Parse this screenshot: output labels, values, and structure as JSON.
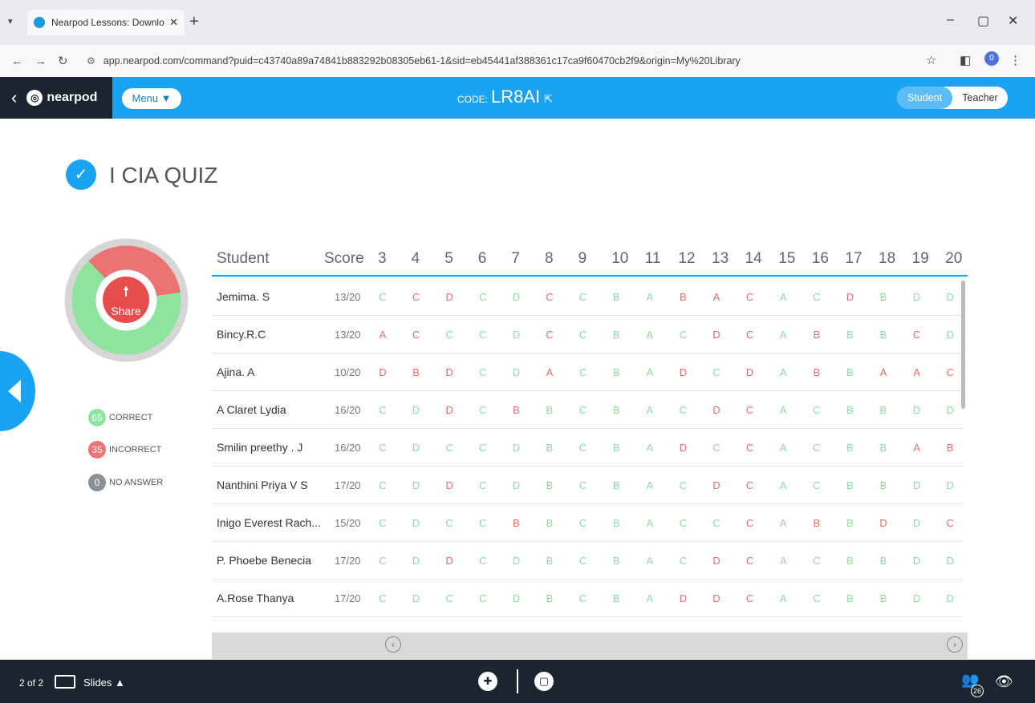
{
  "browser": {
    "tab_title": "Nearpod Lessons: Download re",
    "url": "app.nearpod.com/command?puid=c43740a89a74841b883292b08305eb61-1&sid=eb45441af388361c17ca9f60470cb2f9&origin=My%20Library",
    "profile_initial": "0"
  },
  "header": {
    "logo_text": "nearpod",
    "menu_label": "Menu ▼",
    "code_label": "CODE:",
    "code_value": "LR8AI",
    "role_student": "Student",
    "role_teacher": "Teacher",
    "colors": {
      "header_blue": "#1aa3f0",
      "logo_dark": "#1a2530"
    }
  },
  "quiz": {
    "title": "I CIA QUIZ",
    "share_label": "Share",
    "results": {
      "correct": 65,
      "incorrect": 35,
      "no_answer": 0
    },
    "legend": {
      "correct_count": "65",
      "correct_label": "CORRECT",
      "incorrect_count": "35",
      "incorrect_label": "INCORRECT",
      "no_answer_count": "0",
      "no_answer_label": "NO ANSWER"
    },
    "colors": {
      "correct": "#8ee39e",
      "incorrect": "#ec7373",
      "no_answer": "#8a9096"
    }
  },
  "table": {
    "header_student": "Student",
    "header_score": "Score",
    "question_numbers": [
      "3",
      "4",
      "5",
      "6",
      "7",
      "8",
      "9",
      "10",
      "11",
      "12",
      "13",
      "14",
      "15",
      "16",
      "17",
      "18",
      "19",
      "20"
    ],
    "rows": [
      {
        "name": "Jemima. S",
        "score": "13/20",
        "answers": [
          "C",
          "C",
          "D",
          "C",
          "D",
          "C",
          "C",
          "B",
          "A",
          "B",
          "A",
          "C",
          "A",
          "C",
          "D",
          "B",
          "D",
          "D"
        ],
        "correct": [
          1,
          0,
          0,
          1,
          1,
          0,
          1,
          1,
          1,
          0,
          0,
          0,
          1,
          1,
          0,
          1,
          1,
          1
        ]
      },
      {
        "name": "Bincy.R.C",
        "score": "13/20",
        "answers": [
          "A",
          "C",
          "C",
          "C",
          "D",
          "C",
          "C",
          "B",
          "A",
          "C",
          "D",
          "C",
          "A",
          "B",
          "B",
          "B",
          "C",
          "D"
        ],
        "correct": [
          0,
          0,
          1,
          1,
          1,
          0,
          1,
          1,
          1,
          1,
          0,
          0,
          1,
          0,
          1,
          1,
          0,
          1
        ]
      },
      {
        "name": "Ajina. A",
        "score": "10/20",
        "answers": [
          "D",
          "B",
          "D",
          "C",
          "D",
          "A",
          "C",
          "B",
          "A",
          "D",
          "C",
          "D",
          "A",
          "B",
          "B",
          "A",
          "A",
          "C"
        ],
        "correct": [
          0,
          0,
          0,
          1,
          1,
          0,
          1,
          1,
          1,
          0,
          1,
          0,
          1,
          0,
          1,
          0,
          0,
          0
        ]
      },
      {
        "name": "A Claret Lydia",
        "score": "16/20",
        "answers": [
          "C",
          "D",
          "D",
          "C",
          "B",
          "B",
          "C",
          "B",
          "A",
          "C",
          "D",
          "C",
          "A",
          "C",
          "B",
          "B",
          "D",
          "D"
        ],
        "correct": [
          1,
          1,
          0,
          1,
          0,
          1,
          1,
          1,
          1,
          1,
          0,
          0,
          1,
          1,
          1,
          1,
          1,
          1
        ]
      },
      {
        "name": "Smilin preethy . J",
        "score": "16/20",
        "answers": [
          "C",
          "D",
          "C",
          "C",
          "D",
          "B",
          "C",
          "B",
          "A",
          "D",
          "C",
          "C",
          "A",
          "C",
          "B",
          "B",
          "A",
          "B"
        ],
        "correct": [
          1,
          1,
          1,
          1,
          1,
          1,
          1,
          1,
          1,
          0,
          1,
          0,
          1,
          1,
          1,
          1,
          0,
          0
        ]
      },
      {
        "name": "Nanthini Priya V S",
        "score": "17/20",
        "answers": [
          "C",
          "D",
          "D",
          "C",
          "D",
          "B",
          "C",
          "B",
          "A",
          "C",
          "D",
          "C",
          "A",
          "C",
          "B",
          "B",
          "D",
          "D"
        ],
        "correct": [
          1,
          1,
          0,
          1,
          1,
          1,
          1,
          1,
          1,
          1,
          0,
          0,
          1,
          1,
          1,
          1,
          1,
          1
        ]
      },
      {
        "name": "Inigo Everest Rach...",
        "score": "15/20",
        "answers": [
          "C",
          "D",
          "C",
          "C",
          "B",
          "B",
          "C",
          "B",
          "A",
          "C",
          "C",
          "C",
          "A",
          "B",
          "B",
          "D",
          "D",
          "C"
        ],
        "correct": [
          1,
          1,
          1,
          1,
          0,
          1,
          1,
          1,
          1,
          1,
          1,
          0,
          1,
          0,
          1,
          0,
          1,
          0
        ]
      },
      {
        "name": "P. Phoebe Benecia",
        "score": "17/20",
        "answers": [
          "C",
          "D",
          "D",
          "C",
          "D",
          "B",
          "C",
          "B",
          "A",
          "C",
          "D",
          "C",
          "A",
          "C",
          "B",
          "B",
          "D",
          "D"
        ],
        "correct": [
          1,
          1,
          0,
          1,
          1,
          1,
          1,
          1,
          1,
          1,
          0,
          0,
          1,
          1,
          1,
          1,
          1,
          1
        ]
      },
      {
        "name": "A.Rose Thanya",
        "score": "17/20",
        "answers": [
          "C",
          "D",
          "C",
          "C",
          "D",
          "B",
          "C",
          "B",
          "A",
          "D",
          "D",
          "C",
          "A",
          "C",
          "B",
          "B",
          "D",
          "D"
        ],
        "correct": [
          1,
          1,
          1,
          1,
          1,
          1,
          1,
          1,
          1,
          0,
          0,
          0,
          1,
          1,
          1,
          1,
          1,
          1
        ]
      }
    ]
  },
  "bottom_bar": {
    "slide_position": "2 of 2",
    "slides_label": "Slides ▲",
    "participants": "26"
  }
}
